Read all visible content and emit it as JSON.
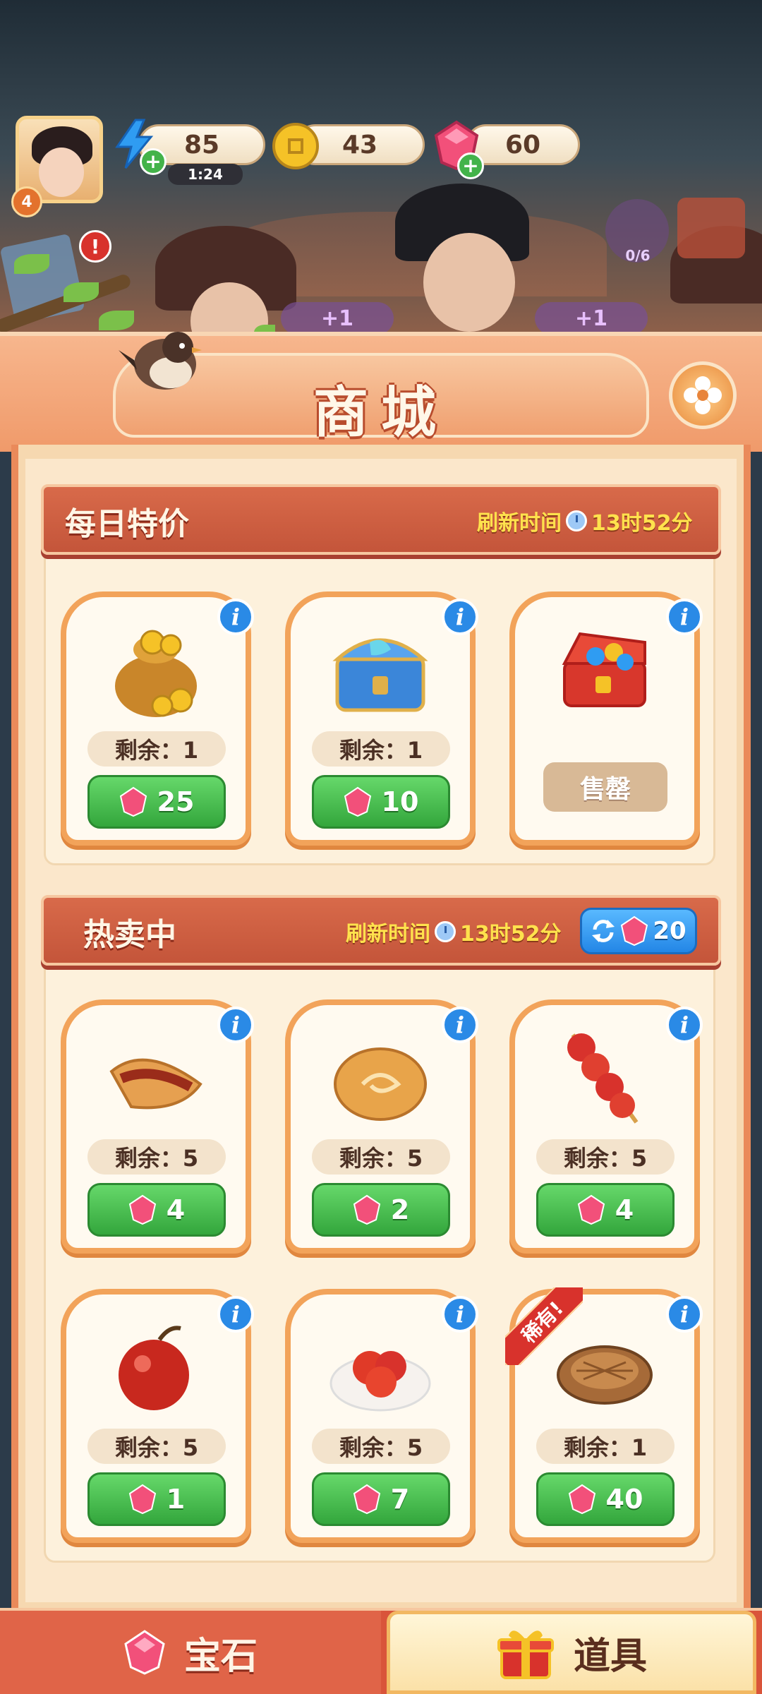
{
  "resources": {
    "energy": "85",
    "energy_timer": "1:24",
    "coins": "43",
    "gems": "60",
    "player_level": "4"
  },
  "header": {
    "title": "商城"
  },
  "daily_deals": {
    "title": "每日特价",
    "refresh_label": "刷新时间",
    "refresh_time": "13时52分",
    "items": [
      {
        "remain": "剩余：1",
        "price": "25"
      },
      {
        "remain": "剩余：1",
        "price": "10"
      },
      {
        "status": "售罄"
      }
    ]
  },
  "hot_sale": {
    "title": "热卖中",
    "refresh_label": "刷新时间",
    "refresh_time": "13时52分",
    "refresh_cost": "20",
    "items": [
      {
        "remain": "剩余：5",
        "price": "4"
      },
      {
        "remain": "剩余：5",
        "price": "2"
      },
      {
        "remain": "剩余：5",
        "price": "4"
      },
      {
        "remain": "剩余：5",
        "price": "1"
      },
      {
        "remain": "剩余：5",
        "price": "7"
      },
      {
        "remain": "剩余：1",
        "price": "40",
        "tag": "稀有!"
      }
    ]
  },
  "tabs": {
    "gems": "宝石",
    "items": "道具"
  },
  "scene": {
    "task_progress": "0/6",
    "bonus_a": "+1",
    "bonus_b": "+1"
  }
}
